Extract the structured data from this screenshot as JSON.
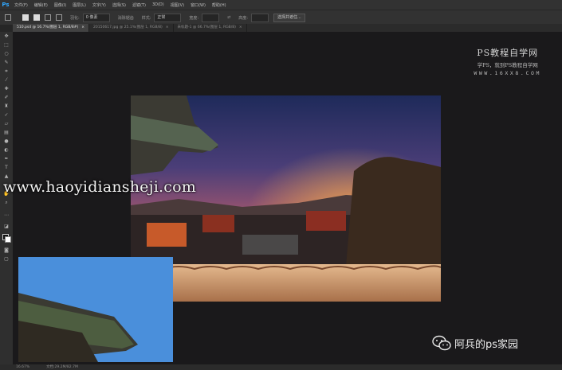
{
  "app": {
    "logo": "Ps"
  },
  "menu": [
    "文件(F)",
    "编辑(E)",
    "图像(I)",
    "图层(L)",
    "文字(Y)",
    "选择(S)",
    "滤镜(T)",
    "3D(D)",
    "视图(V)",
    "窗口(W)",
    "帮助(H)"
  ],
  "options": {
    "feather_label": "羽化:",
    "feather_value": "0 像素",
    "antialias_label": "消除锯齿",
    "style_label": "样式:",
    "style_value": "正常",
    "width_label": "宽度:",
    "height_label": "高度:",
    "refine_button": "选择并遮住..."
  },
  "tabs": [
    {
      "label": "510.psd @ 16.7%(图层 1, RGB/8#)",
      "active": true
    },
    {
      "label": "20150617.jpg @ 25.1%(图层 1, RGB/8)",
      "active": false
    },
    {
      "label": "未标题-1 @ 66.7%(图层 1, RGB/8)",
      "active": false
    }
  ],
  "watermark": {
    "title": "PS教程自学网",
    "subtitle": "学PS，就到PS教程自学网",
    "url": "WWW.16XX8.COM",
    "center_url": "www.haoyidiansheji.com",
    "brand": "阿兵的ps家园"
  },
  "status": {
    "zoom": "16.67%",
    "doc": "文档:29.2M/82.7M"
  },
  "colors": {
    "canvas": "#1a191b",
    "ps_blue": "#31a8ff"
  }
}
